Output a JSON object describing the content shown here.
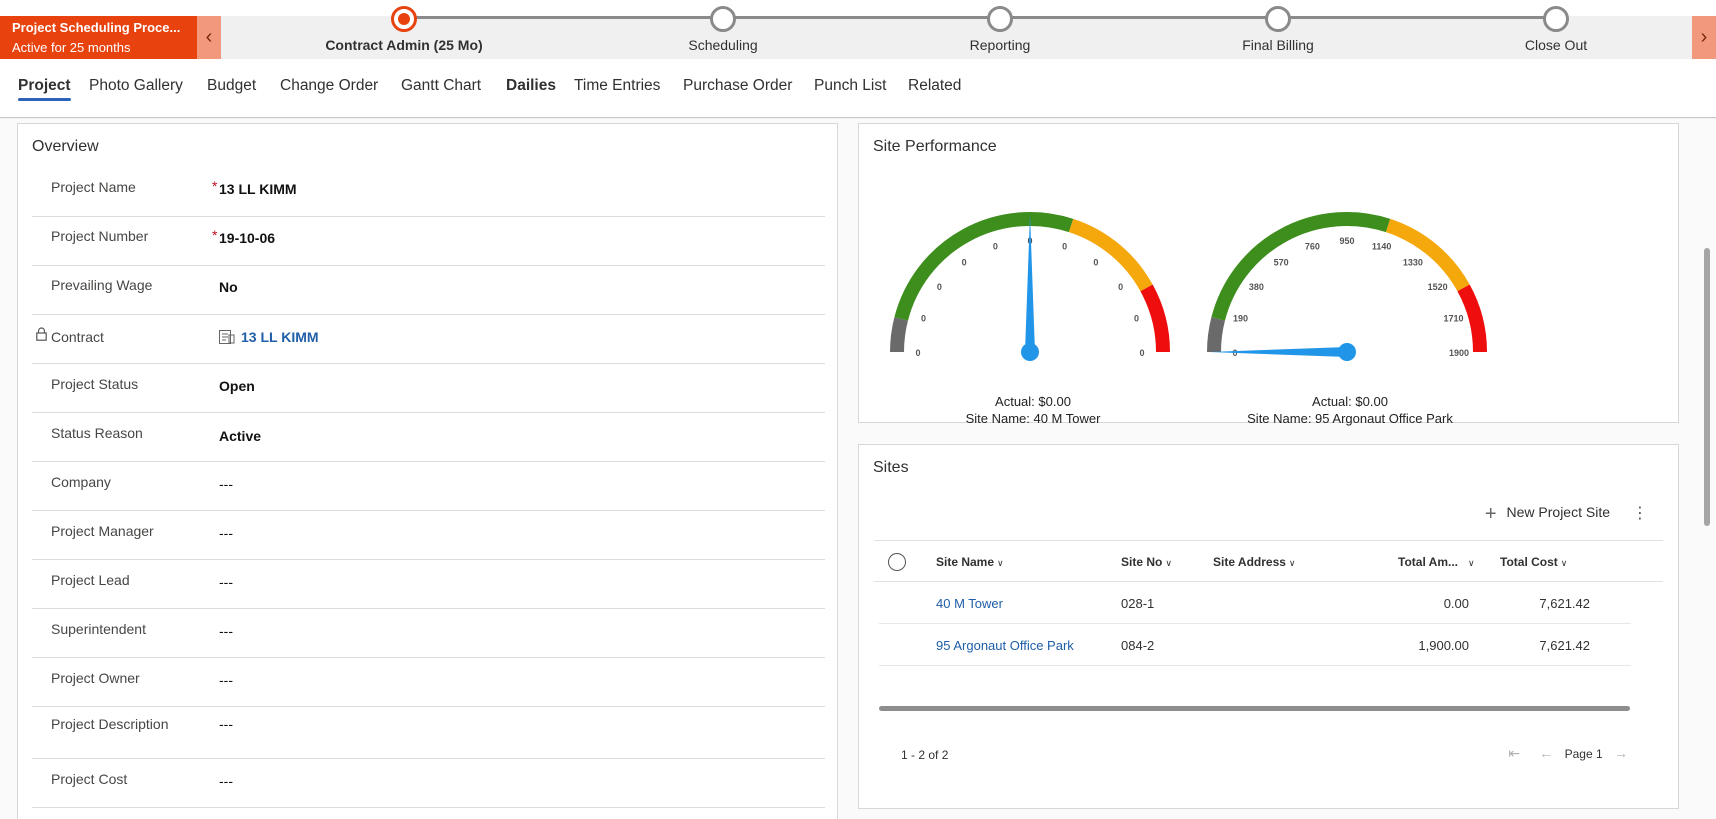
{
  "bpf": {
    "active_title": "Project Scheduling Proce...",
    "active_subtitle": "Active for 25 months",
    "prev_icon": "chevron-left-icon",
    "next_icon": "chevron-right-icon",
    "stages": [
      {
        "label": "Contract Admin  (25 Mo)",
        "active": true
      },
      {
        "label": "Scheduling",
        "active": false
      },
      {
        "label": "Reporting",
        "active": false
      },
      {
        "label": "Final Billing",
        "active": false
      },
      {
        "label": "Close Out",
        "active": false
      }
    ],
    "active_color": "#e8420e"
  },
  "tabs": [
    "Project",
    "Photo Gallery",
    "Budget",
    "Change Order",
    "Gantt Chart",
    "Dailies",
    "Time Entries",
    "Purchase Order",
    "Punch List",
    "Related"
  ],
  "overview": {
    "title": "Overview",
    "fields": [
      {
        "label": "Project Name",
        "required": "*",
        "value": "13 LL KIMM"
      },
      {
        "label": "Project Number",
        "required": "*",
        "value": "19-10-06"
      },
      {
        "label": "Prevailing Wage",
        "value": "No"
      },
      {
        "label": "Contract",
        "value": "13 LL KIMM"
      },
      {
        "label": "Project Status",
        "value": "Open"
      },
      {
        "label": "Status Reason",
        "value": "Active"
      },
      {
        "label": "Company",
        "value": "---"
      },
      {
        "label": "Project Manager",
        "value": "---"
      },
      {
        "label": "Project Lead",
        "value": "---"
      },
      {
        "label": "Superintendent",
        "value": "---"
      },
      {
        "label": "Project Owner",
        "value": "---"
      },
      {
        "label": "Project Description",
        "value": "---"
      },
      {
        "label": "Project Cost",
        "value": "---"
      }
    ]
  },
  "performance": {
    "title": "Site Performance",
    "gauges": [
      {
        "ticks": [
          "0",
          "0",
          "0",
          "0",
          "0",
          "0",
          "0",
          "0",
          "0",
          "0",
          "0"
        ],
        "actual": "Actual: $0.00",
        "site": "Site Name: 40 M Tower",
        "min": 0,
        "max": 1,
        "value": 0.5
      },
      {
        "ticks": [
          "0",
          "190",
          "380",
          "570",
          "760",
          "950",
          "1140",
          "1330",
          "1520",
          "1710",
          "1900"
        ],
        "actual": "Actual: $0.00",
        "site": "Site Name: 95 Argonaut Office Park",
        "min": 0,
        "max": 1900,
        "value": 0
      }
    ],
    "colors": {
      "grey": "#6a6a6a",
      "green": "#3e8e1e",
      "orange": "#f5a80c",
      "red": "#ee0e0e",
      "needle": "#2196e8"
    }
  },
  "sites": {
    "title": "Sites",
    "new_button": "New Project Site",
    "columns": [
      "Site Name",
      "Site No",
      "Site Address",
      "Total Am...",
      "Total Cost"
    ],
    "rows": [
      {
        "name": "40 M Tower",
        "no": "028-1",
        "address": "",
        "amount": "0.00",
        "cost": "7,621.42"
      },
      {
        "name": "95 Argonaut Office Park",
        "no": "084-2",
        "address": "",
        "amount": "1,900.00",
        "cost": "7,621.42"
      }
    ],
    "record_count": "1 - 2 of 2",
    "page_label": "Page 1"
  }
}
